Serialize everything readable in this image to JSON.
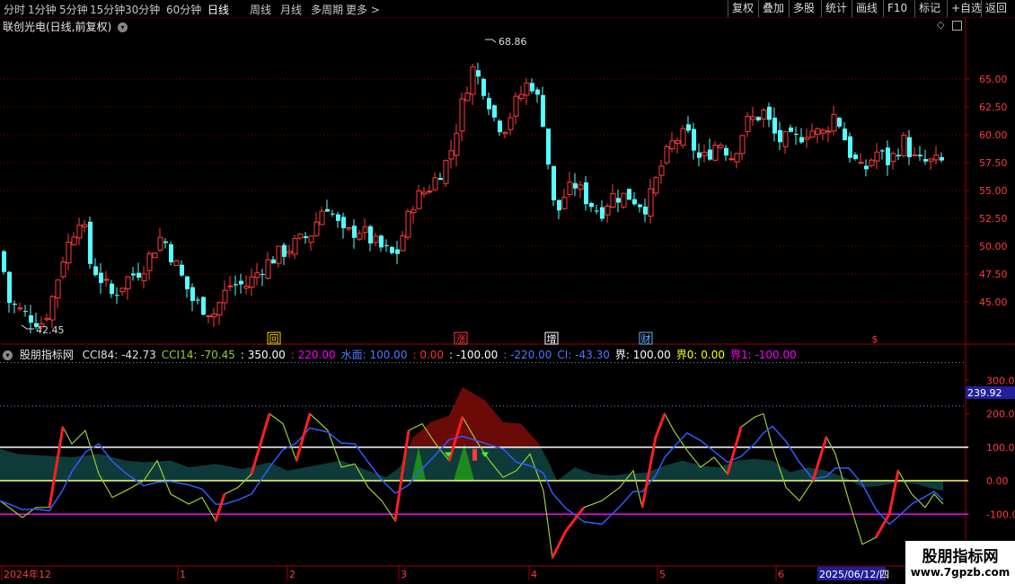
{
  "toolbar": {
    "timeframes": [
      "分时",
      "1分钟",
      "5分钟",
      "15分钟",
      "30分钟",
      "60分钟",
      "日线",
      "周线",
      "月线",
      "多周期",
      "更多 >"
    ],
    "active_timeframe": "日线",
    "tools": [
      "复权",
      "叠加",
      "多股",
      "统计",
      "画线",
      "F10",
      "标记",
      "+自选",
      "返回"
    ]
  },
  "main_chart": {
    "title": "联创光电(日线,前复权)",
    "price_high_label": "68.86",
    "price_low_label": "42.45",
    "y_ticks": [
      "65.00",
      "62.50",
      "60.00",
      "57.50",
      "55.00",
      "52.50",
      "50.00",
      "47.50",
      "45.00"
    ],
    "event_markers": [
      "回",
      "涨",
      "增",
      "财",
      "$"
    ]
  },
  "indicator": {
    "name": "股朋指标网",
    "values": [
      {
        "label": "CCI84: -42.73",
        "color": "#e0e0e0"
      },
      {
        "label": "CCI14: -70.45",
        "color": "#9acd32"
      },
      {
        "label": ": 350.00",
        "color": "#ffffff"
      },
      {
        "label": ": 220.00",
        "color": "#ff00ff"
      },
      {
        "label": "水面: 100.00",
        "color": "#4a7bff"
      },
      {
        "label": ": 0.00",
        "color": "#ff3030"
      },
      {
        "label": ": -100.00",
        "color": "#ffffff"
      },
      {
        "label": ": -220.00",
        "color": "#4a7bff"
      },
      {
        "label": "CI: -43.30",
        "color": "#4a7bff"
      },
      {
        "label": "界: 100.00",
        "color": "#ffffff"
      },
      {
        "label": "界0: 0.00",
        "color": "#ffff00"
      },
      {
        "label": "界1: -100.00",
        "color": "#ff00ff"
      }
    ],
    "y_ticks": [
      "300.0",
      "200.0",
      "100.0",
      "0.00",
      "-100.0"
    ],
    "current_value": "239.92"
  },
  "time_axis": {
    "labels": [
      "2024年12",
      "1",
      "2",
      "3",
      "4",
      "5",
      "6"
    ],
    "cursor_date": "2025/06/12/四"
  },
  "watermark": {
    "title": "股朋指标网",
    "url": "www.7gpzb.com"
  },
  "colors": {
    "up": "#ff3b3b",
    "down": "#54ffff",
    "grid": "#7a0000",
    "axis": "#a00000",
    "teal": "#0e3b3a",
    "darkred": "#6a0b08"
  }
}
